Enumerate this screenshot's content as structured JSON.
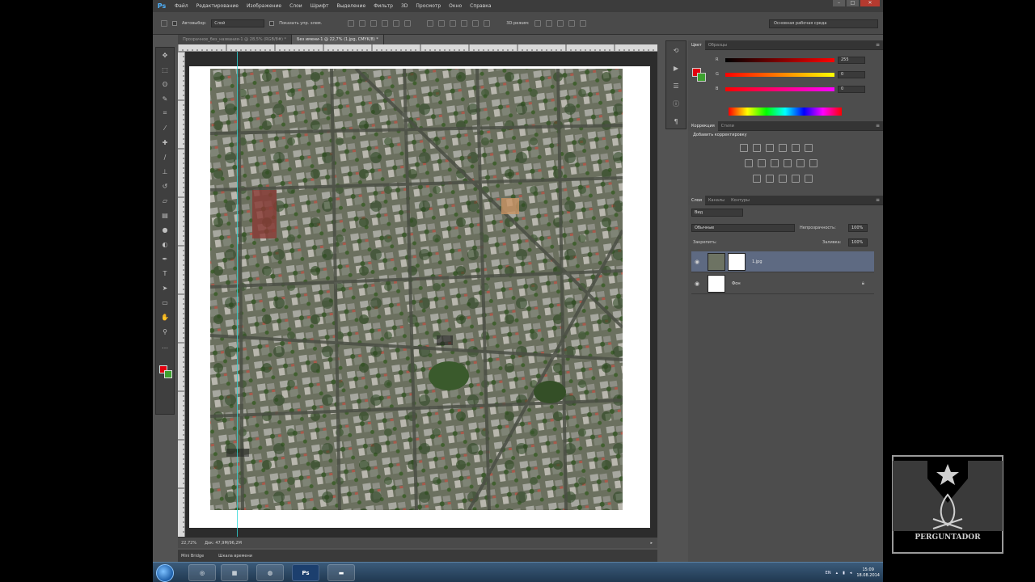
{
  "app": {
    "logo": "Ps",
    "menu": [
      "Файл",
      "Редактирование",
      "Изображение",
      "Слои",
      "Шрифт",
      "Выделение",
      "Фильтр",
      "3D",
      "Просмотр",
      "Окно",
      "Справка"
    ],
    "window_controls": [
      "–",
      "□",
      "✕"
    ]
  },
  "options_bar": {
    "autoselect_label": "Автовыбор:",
    "autoselect_value": "Слой",
    "show_transform_label": "Показать упр. элем.",
    "mode_3d_label": "3D-режим:",
    "workspace": "Основная рабочая среда"
  },
  "tabs": [
    {
      "label": "Прозрачное_без_названия-1 @ 28,5% (RGB/8#) *",
      "active": false
    },
    {
      "label": "Без имени-1 @ 22,7% (1.jpg, CMYK/8) *",
      "active": true
    }
  ],
  "status": {
    "zoom": "22,72%",
    "doc": "Док: 47,9M/96,2M"
  },
  "bottom_panel": {
    "tabs": [
      "Mini Bridge",
      "Шкала времени"
    ]
  },
  "color_panel": {
    "tabs": [
      "Цвет",
      "Образцы"
    ],
    "sliders": [
      {
        "label": "R",
        "value": "255",
        "gradient": [
          "#000000",
          "#ff0000"
        ]
      },
      {
        "label": "G",
        "value": "0",
        "gradient": [
          "#ff0000",
          "#ffff00"
        ]
      },
      {
        "label": "B",
        "value": "0",
        "gradient": [
          "#ff0000",
          "#ff00ff"
        ]
      }
    ],
    "foreground": "#e3000e",
    "background": "#3da12f"
  },
  "adjustments_panel": {
    "tabs": [
      "Коррекция",
      "Стили"
    ],
    "title": "Добавить корректировку"
  },
  "layers_panel": {
    "tabs": [
      "Слои",
      "Каналы",
      "Контуры"
    ],
    "filter": "Вид",
    "blend_mode": "Обычные",
    "opacity_label": "Непрозрачность:",
    "opacity_value": "100%",
    "lock_label": "Закрепить:",
    "fill_label": "Заливка:",
    "fill_value": "100%",
    "layers": [
      {
        "name": "1.jpg",
        "selected": true,
        "thumb": "map",
        "mask": true
      },
      {
        "name": "Фон",
        "selected": false,
        "thumb": "white",
        "locked": true
      }
    ]
  },
  "taskbar": {
    "apps": [
      "ie",
      "firefox",
      "explorer",
      "chrome",
      "Ps",
      "folder"
    ],
    "lang": "EN",
    "time": "15:09",
    "date": "18.08.2014"
  },
  "watermark": {
    "text": "PERGUNTADOR"
  }
}
